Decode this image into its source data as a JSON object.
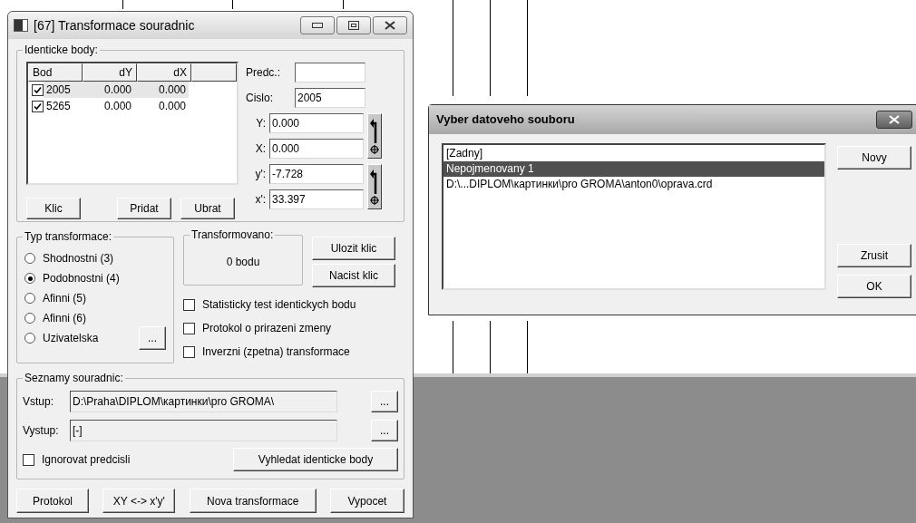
{
  "main_window": {
    "title": "[67] Transformace souradnic",
    "identical_points": {
      "legend": "Identicke body:",
      "columns": [
        "Bod",
        "dY",
        "dX"
      ],
      "rows": [
        {
          "checked": true,
          "selected": true,
          "cells": [
            "2005",
            "0.000",
            "0.000"
          ]
        },
        {
          "checked": true,
          "selected": false,
          "cells": [
            "5265",
            "0.000",
            "0.000"
          ]
        }
      ],
      "prefix": {
        "label": "Predc.:"
      },
      "number": {
        "label": "Cislo:",
        "value": "2005"
      },
      "coordinate_pairs": [
        [
          {
            "label": "Y:",
            "value": "0.000"
          },
          {
            "label": "X:",
            "value": "0.000"
          }
        ],
        [
          {
            "label": "y':",
            "value": "-7.728"
          },
          {
            "label": "x':",
            "value": "33.397"
          }
        ]
      ],
      "buttons": [
        "Klic",
        "Pridat",
        "Ubrat"
      ]
    },
    "transformation_type": {
      "legend": "Typ transformace:",
      "options": [
        {
          "label": "Shodnostni (3)",
          "selected": false
        },
        {
          "label": "Podobnostni (4)",
          "selected": true
        },
        {
          "label": "Afinni (5)",
          "selected": false
        },
        {
          "label": "Afinni (6)",
          "selected": false
        },
        {
          "label": "Uzivatelska",
          "selected": false
        }
      ],
      "custom_button": "..."
    },
    "transformed": {
      "legend": "Transformovano:",
      "count": "0 bodu"
    },
    "key_buttons": [
      "Ulozit klic",
      "Nacist klic"
    ],
    "options": [
      {
        "label": "Statisticky test identickych bodu",
        "checked": false
      },
      {
        "label": "Protokol o prirazeni zmeny",
        "checked": false
      },
      {
        "label": "Inverzni (zpetna) transformace",
        "checked": false
      }
    ],
    "coordinate_lists": {
      "legend": "Seznamy souradnic:",
      "files": [
        {
          "label": "Vstup:",
          "value": "D:\\Praha\\DIPLOM\\картинки\\pro GROMA\\",
          "browse": "..."
        },
        {
          "label": "Vystup:",
          "value": "[-]",
          "browse": "..."
        }
      ],
      "ignore_prefix": {
        "label": "Ignorovat predcisli",
        "checked": false
      },
      "find_button": "Vyhledat identicke body"
    },
    "bottom_buttons": [
      "Protokol",
      "XY <-> x'y'",
      "Nova transformace",
      "Vypocet"
    ]
  },
  "file_dialog": {
    "title": "Vyber datoveho souboru",
    "items": [
      {
        "label": "[Zadny]",
        "selected": false
      },
      {
        "label": "Nepojmenovany 1",
        "selected": true
      },
      {
        "label": "D:\\...DIPLOM\\картинки\\pro GROMA\\anton0\\oprava.crd",
        "selected": false
      }
    ],
    "buttons": [
      "Novy",
      "Zrusit",
      "OK"
    ]
  }
}
